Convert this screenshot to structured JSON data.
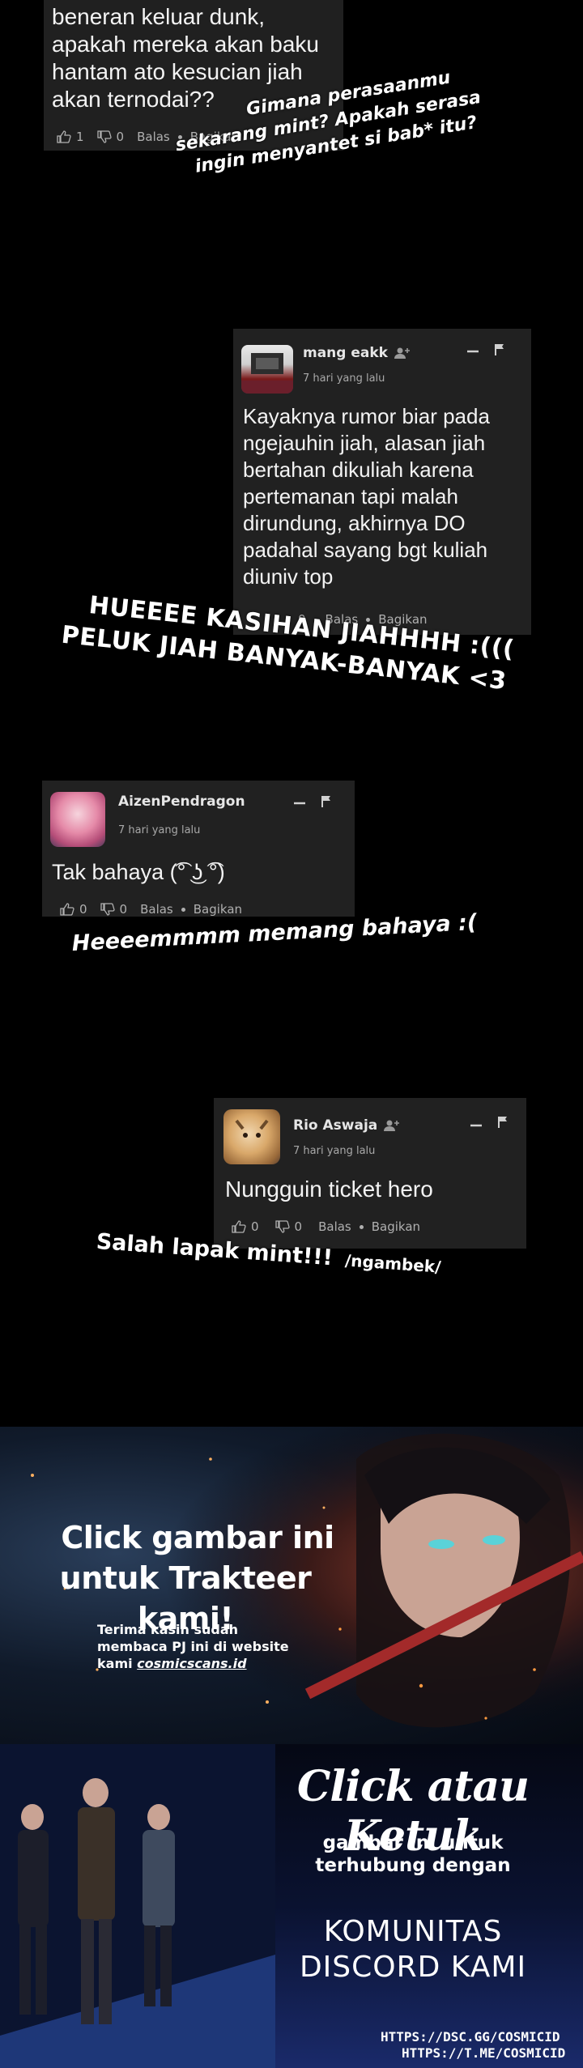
{
  "comment1": {
    "text_lines": [
      "beneran keluar dunk,",
      "apakah mereka akan baku",
      "hantam ato kesucian jiah",
      "akan ternodai??"
    ],
    "likes": "1",
    "dislikes": "0",
    "reply_label": "Balas",
    "share_label": "Bagikan"
  },
  "caption1": [
    "Gimana perasaanmu",
    "sekarang mint? Apakah serasa",
    "ingin menyantet si bab* itu?"
  ],
  "comment2": {
    "username": "mang eakk",
    "time": "7 hari yang lalu",
    "text_lines": [
      "Kayaknya rumor biar pada",
      "ngejauhin jiah, alasan jiah",
      "bertahan dikuliah karena",
      "pertemanan tapi malah",
      "dirundung, akhirnya DO",
      "padahal sayang bgt kuliah",
      "diuniv top"
    ],
    "likes": "0",
    "dislikes": "",
    "reply_label": "Balas",
    "share_label": "Bagikan"
  },
  "caption2": [
    "HUEEEE KASIHAN JIAHHHH :(((",
    "PELUK JIAH BANYAK-BANYAK <3"
  ],
  "comment3": {
    "username": "AizenPendragon",
    "time": "7 hari yang lalu",
    "text": "Tak bahaya (͡° ͜ʖ ͡°)",
    "likes": "0",
    "dislikes": "0",
    "reply_label": "Balas",
    "share_label": "Bagikan"
  },
  "caption3": "Heeeemmmm memang bahaya :(",
  "comment4": {
    "username": "Rio Aswaja",
    "time": "7 hari yang lalu",
    "text": "Nungguin ticket hero",
    "likes": "0",
    "dislikes": "0",
    "reply_label": "Balas",
    "share_label": "Bagikan"
  },
  "caption4": {
    "main": "Salah lapak mint!!!",
    "small": "/ngambek/"
  },
  "banner1": {
    "title_lines": [
      "Click gambar ini",
      "untuk Trakteer kami!"
    ],
    "sub_lines": [
      "Terima kasih sudah",
      "membaca PJ ini di website",
      "kami "
    ],
    "site": "cosmicscans.id"
  },
  "banner2": {
    "title": "Click atau Ketuk",
    "sub_lines": [
      "gambar ini untuk",
      "terhubung dengan"
    ],
    "big_lines": [
      "KOMUNITAS",
      "DISCORD KAMI"
    ],
    "links": [
      "HTTPS://DSC.GG/COSMICID",
      "HTTPS://T.ME/COSMICID"
    ]
  },
  "icons": {
    "like": "thumbs-up-icon",
    "dislike": "thumbs-down-icon",
    "add_user": "add-user-icon",
    "collapse": "minus-icon",
    "flag": "flag-icon"
  }
}
